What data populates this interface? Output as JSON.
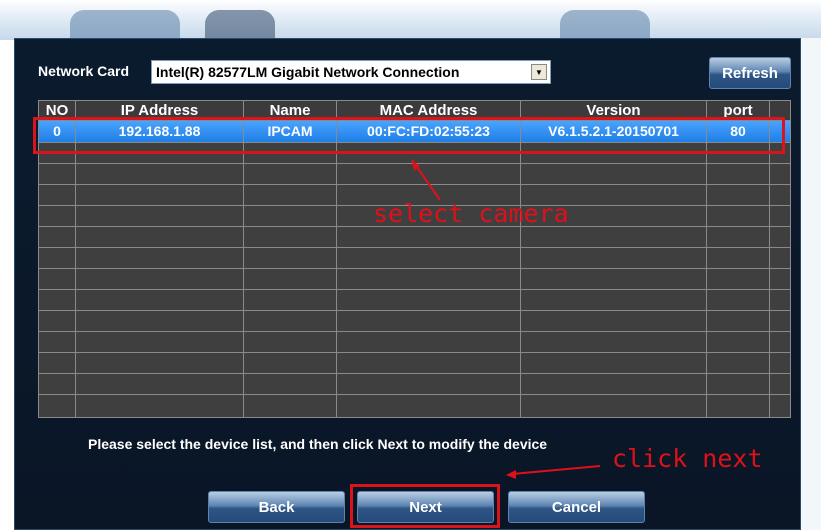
{
  "network_card": {
    "label": "Network Card",
    "selected": "Intel(R) 82577LM Gigabit Network Connection"
  },
  "toolbar": {
    "refresh_label": "Refresh"
  },
  "table": {
    "columns": [
      "NO",
      "IP Address",
      "Name",
      "MAC Address",
      "Version",
      "port"
    ],
    "rows": [
      {
        "no": "0",
        "ip": "192.168.1.88",
        "name": "IPCAM",
        "mac": "00:FC:FD:02:55:23",
        "version": "V6.1.5.2.1-20150701",
        "port": "80"
      }
    ]
  },
  "instruction": "Please select the device list, and then click Next to modify the device",
  "buttons": {
    "back": "Back",
    "next": "Next",
    "cancel": "Cancel"
  },
  "annotations": {
    "select_camera": "select camera",
    "click_next": "click next"
  },
  "colors": {
    "annotation_red": "#d9141b",
    "selected_row": "#1e7fe6",
    "dialog_bg": "#0b1b2e"
  }
}
